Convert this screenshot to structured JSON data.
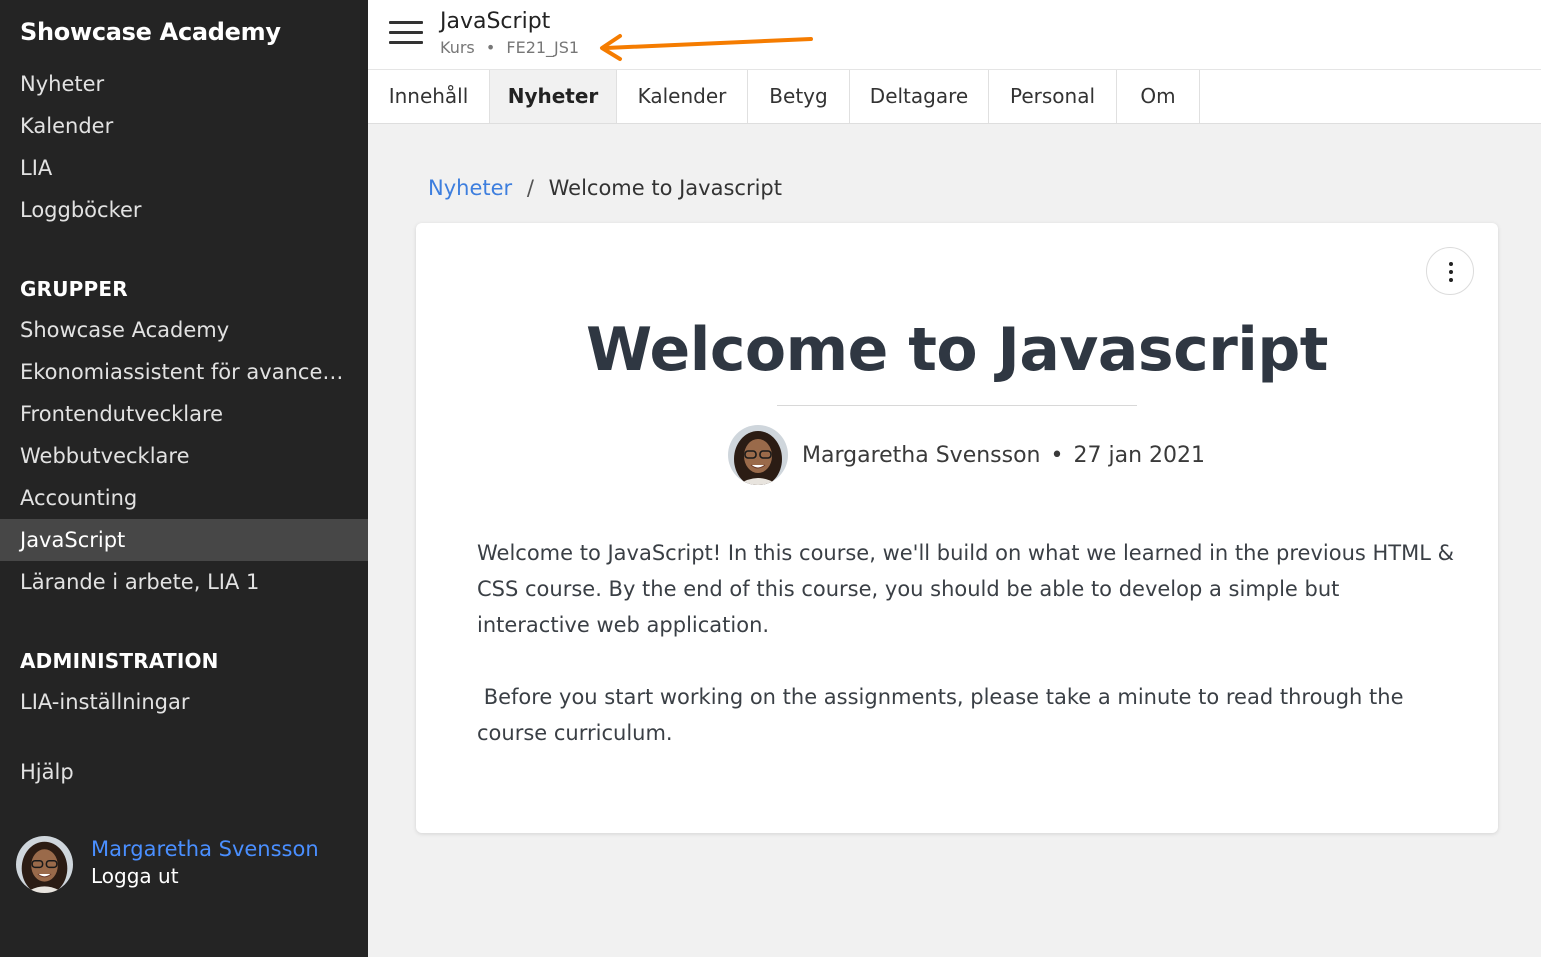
{
  "sidebar": {
    "brand": "Showcase Academy",
    "main_items": [
      "Nyheter",
      "Kalender",
      "LIA",
      "Loggböcker"
    ],
    "groups_heading": "GRUPPER",
    "groups": [
      "Showcase Academy",
      "Ekonomiassistent för avancerad...",
      "Frontendutvecklare",
      "Webbutvecklare",
      "Accounting",
      "JavaScript",
      "Lärande i arbete, LIA 1"
    ],
    "active_group": "JavaScript",
    "admin_heading": "ADMINISTRATION",
    "admin_items": [
      "LIA-inställningar"
    ],
    "help": "Hjälp",
    "user": {
      "name": "Margaretha Svensson",
      "logout": "Logga ut"
    }
  },
  "header": {
    "title": "JavaScript",
    "type": "Kurs",
    "separator": "•",
    "code": "FE21_JS1",
    "annotation_arrow_color": "#f57c00"
  },
  "tabs": [
    "Innehåll",
    "Nyheter",
    "Kalender",
    "Betyg",
    "Deltagare",
    "Personal",
    "Om"
  ],
  "active_tab": "Nyheter",
  "breadcrumb": {
    "link": "Nyheter",
    "separator": "/",
    "current": "Welcome to Javascript"
  },
  "post": {
    "title": "Welcome to Javascript",
    "author": "Margaretha Svensson",
    "dot": "•",
    "date": "27 jan 2021",
    "paragraphs": [
      "Welcome to JavaScript! In this course, we'll build on what we learned in the previous HTML & CSS course. By the end of this course, you should be able to develop a simple but interactive web application.",
      " Before you start working on the assignments, please take a minute to read through the course curriculum."
    ]
  },
  "colors": {
    "sidebar_bg": "#242424",
    "active_item_bg": "#474747",
    "link": "#3d7ede",
    "user_link": "#4a8fff",
    "content_bg": "#f1f1f1"
  }
}
